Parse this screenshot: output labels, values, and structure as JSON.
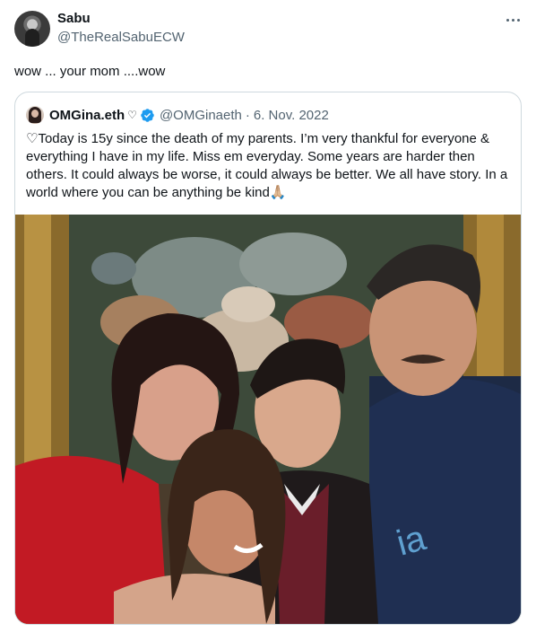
{
  "tweet": {
    "author_name": "Sabu",
    "author_handle": "@TheRealSabuECW",
    "text": "wow ... your mom ....wow"
  },
  "quote": {
    "author_name": "OMGina.eth",
    "name_symbol": "♡",
    "author_handle": "@OMGinaeth",
    "separator": "·",
    "date": "6. Nov. 2022",
    "text": "♡Today is 15y since the death of my parents. I’m very thankful for everyone & everything I have in my life. Miss em everyday. Some years are harder then others. It could always be worse, it could always be better. We all have story. In a world where you can be anything be kind🙏🏼",
    "image_alt": "Family photo of four people posing in front of a framed floral painting"
  },
  "icons": {
    "more": "more-horizontal-icon",
    "verified": "verified-badge-icon"
  },
  "colors": {
    "text_primary": "#0f1419",
    "text_secondary": "#536471",
    "border": "#cfd9de",
    "verified_blue": "#1d9bf0"
  }
}
